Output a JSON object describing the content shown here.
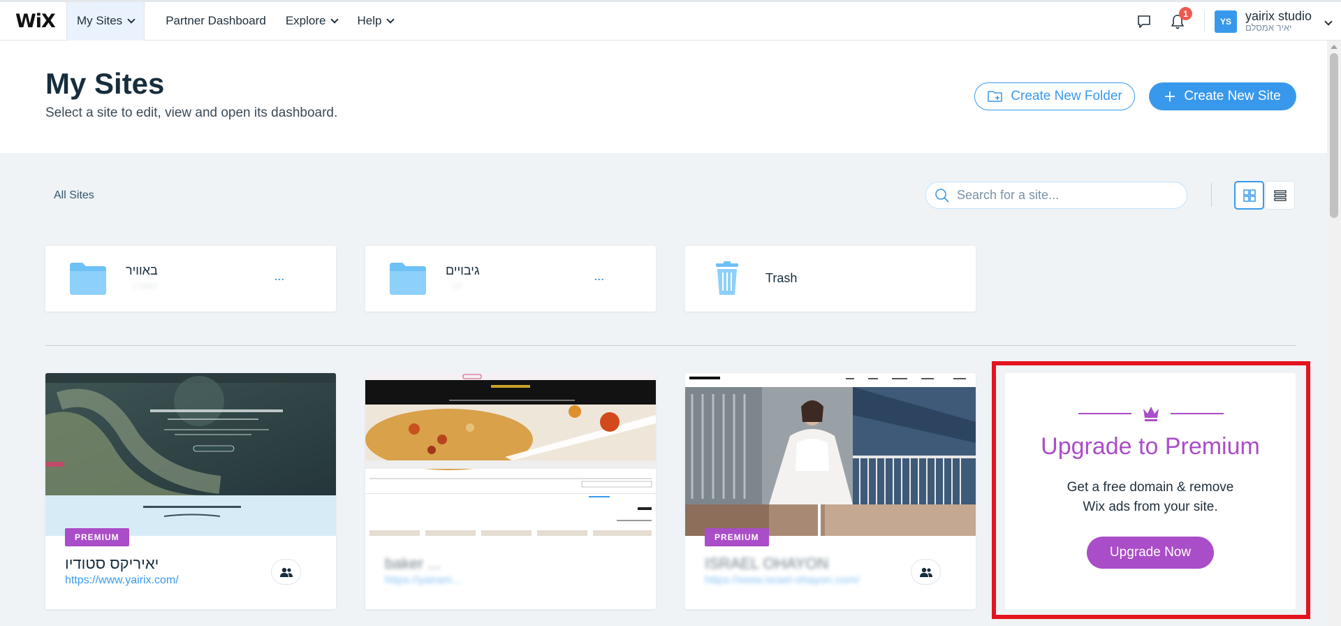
{
  "topbar": {
    "logo": "WiX",
    "nav": [
      {
        "label": "My Sites"
      },
      {
        "label": "Partner Dashboard"
      },
      {
        "label": "Explore"
      },
      {
        "label": "Help"
      }
    ],
    "notification_count": "1",
    "account": {
      "initials": "YS",
      "name": "yairix studio",
      "subname": "יאיר אמסלם"
    }
  },
  "header": {
    "title": "My Sites",
    "subtitle": "Select a site to edit, view and open its dashboard.",
    "create_folder_label": "Create New Folder",
    "create_site_label": "Create New Site"
  },
  "toolbar": {
    "filter_label": "All Sites",
    "search_placeholder": "Search for a site..."
  },
  "folders": [
    {
      "name": "באוויר",
      "count": "2 Sites",
      "more": "..."
    },
    {
      "name": "גיבויים",
      "count": "24",
      "more": "..."
    },
    {
      "name": "Trash"
    }
  ],
  "sites": [
    {
      "name": "יאיריקס סטודיו",
      "url": "https://www.yairix.com/",
      "premium_label": "PREMIUM"
    },
    {
      "name": "baker ...",
      "url": "https://yairam...",
      "premium_label": ""
    },
    {
      "name": "ISRAEL OHAYON",
      "url": "https://www.israel-ohayon.com/",
      "premium_label": "PREMIUM"
    }
  ],
  "upgrade": {
    "title": "Upgrade to Premium",
    "line1": "Get a free domain & remove",
    "line2": "Wix ads from your site.",
    "button_label": "Upgrade Now"
  },
  "colors": {
    "accent": "#3899ec",
    "premium": "#aa4dc8",
    "highlight_frame": "#e4141f",
    "background": "#eff3f6"
  }
}
